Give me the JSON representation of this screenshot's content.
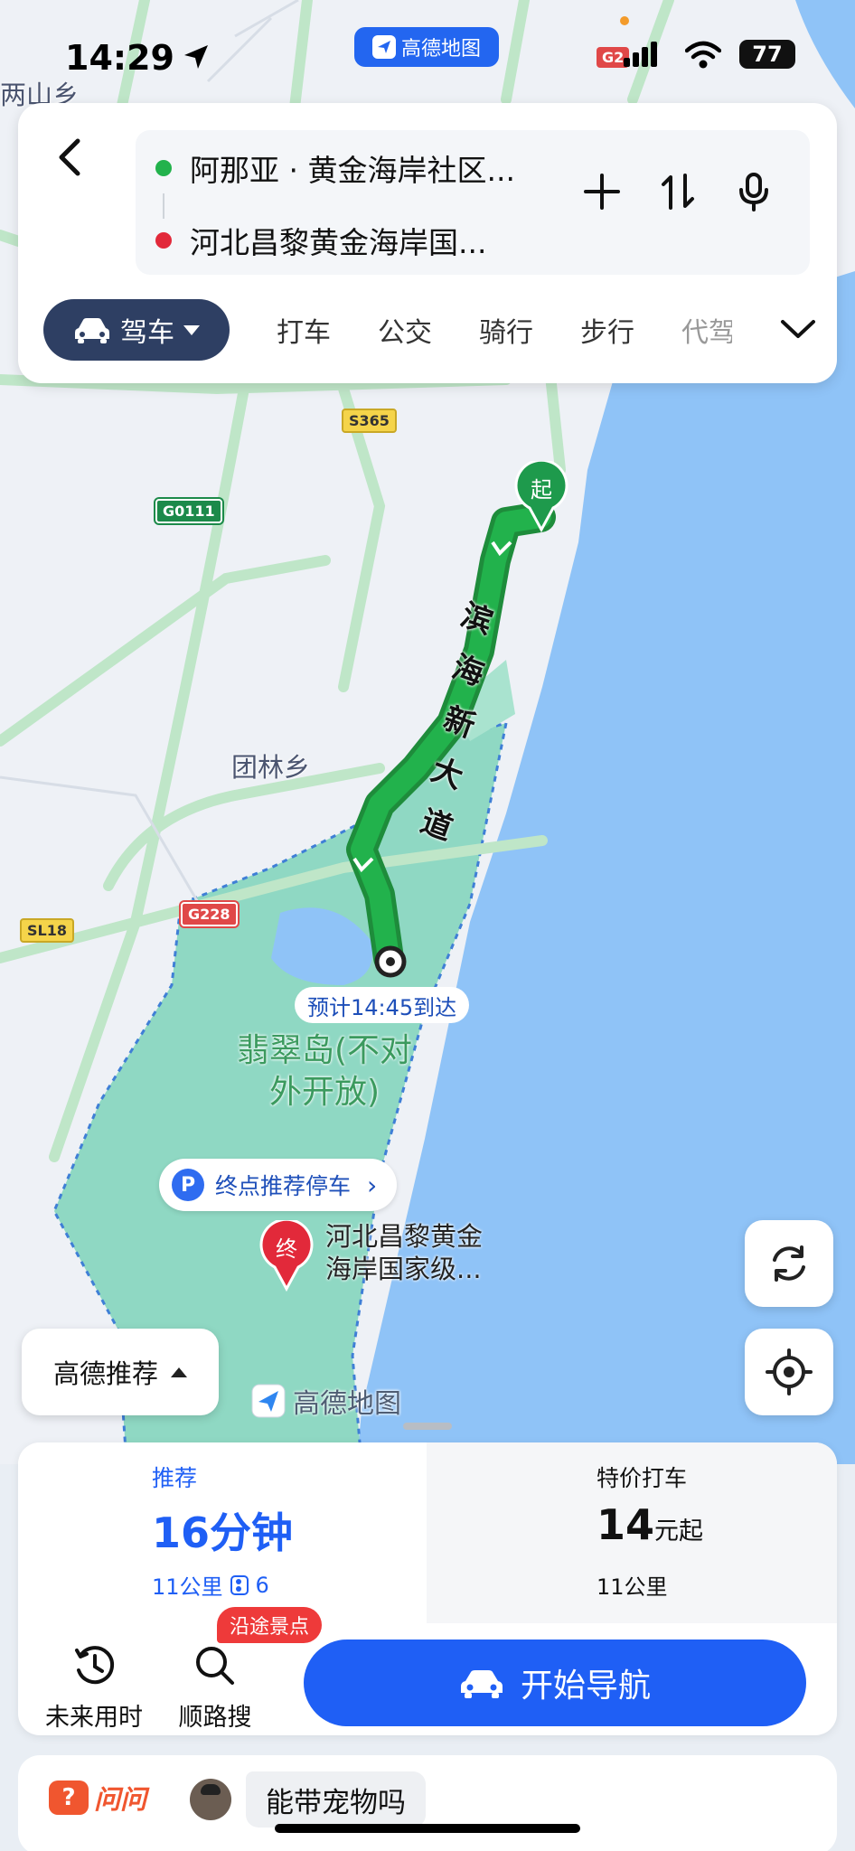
{
  "status_bar": {
    "time": "14:29",
    "app_pill": "高德地图",
    "battery": "77"
  },
  "route_panel": {
    "origin": "阿那亚 · 黄金海岸社区...",
    "destination": "河北昌黎黄金海岸国...",
    "modes": [
      {
        "label": "驾车",
        "selected": true
      },
      {
        "label": "打车"
      },
      {
        "label": "公交"
      },
      {
        "label": "骑行"
      },
      {
        "label": "步行"
      },
      {
        "label": "代驾"
      }
    ]
  },
  "map": {
    "eta_label": "预计14:45到达",
    "road_name": [
      "滨",
      "海",
      "新",
      "大",
      "道"
    ],
    "start_marker": "起",
    "end_marker": "终",
    "parking_pill": "终点推荐停车",
    "parking_icon": "P",
    "destination_label": [
      "河北昌黎黄金",
      "海岸国家级..."
    ],
    "island_label": [
      "翡翠岛(不对",
      "外开放)"
    ],
    "places": [
      "两山乡",
      "团林乡"
    ],
    "shields": [
      "S365",
      "G0111",
      "G228",
      "SL18",
      "G2"
    ],
    "recommend_chip": "高德推荐",
    "watermark": "高德地图",
    "colors": {
      "route": "#22b24c",
      "sea": "#8fc3f7",
      "park": "#8fd8c3",
      "road": "#bfe6c8"
    }
  },
  "plans": {
    "selected": {
      "tag": "推荐",
      "duration_num": "16",
      "duration_unit": "分钟",
      "distance": "11公里",
      "traffic_lights": "6"
    },
    "taxi": {
      "tag": "特价打车",
      "price_num": "14",
      "price_unit": "元起",
      "distance": "11公里"
    }
  },
  "actions": {
    "future_time": "未来用时",
    "along_search": "顺路搜",
    "along_badge": "沿途景点",
    "start_nav": "开始导航"
  },
  "ask": {
    "logo": "问问",
    "logo_icon": "?",
    "question": "能带宠物吗"
  }
}
